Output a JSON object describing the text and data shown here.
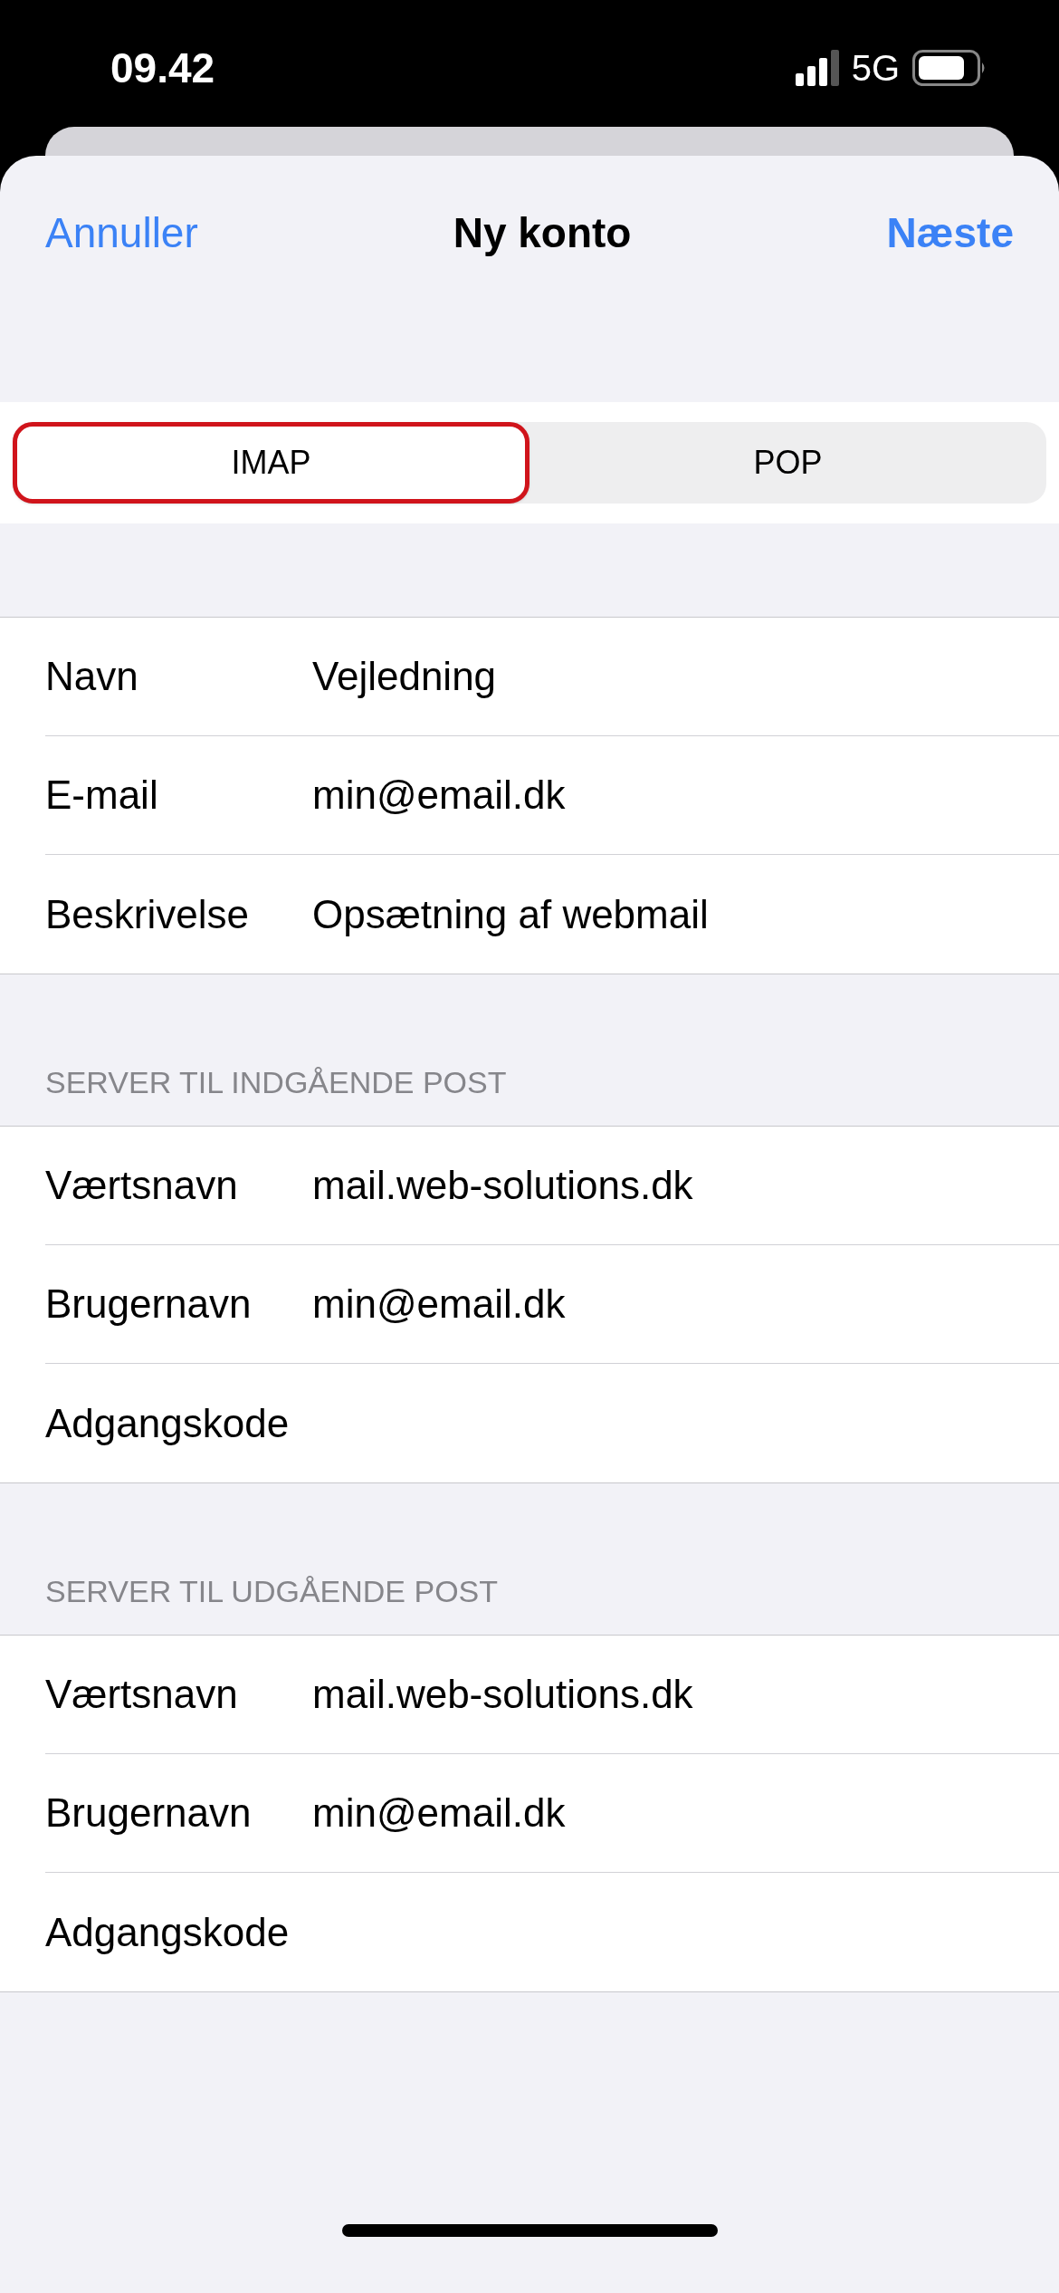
{
  "status_bar": {
    "time": "09.42",
    "network": "5G"
  },
  "nav": {
    "cancel": "Annuller",
    "title": "Ny konto",
    "next": "Næste"
  },
  "segments": [
    {
      "label": "IMAP",
      "selected": true,
      "outlined": true
    },
    {
      "label": "POP",
      "selected": false,
      "outlined": false
    }
  ],
  "sections": [
    {
      "rows": [
        {
          "label": "Navn",
          "value": "Vejledning"
        },
        {
          "label": "E-mail",
          "value": "min@email.dk"
        },
        {
          "label": "Beskrivelse",
          "value": "Opsætning af webmail"
        }
      ]
    },
    {
      "header": "SERVER TIL INDGÅENDE POST",
      "rows": [
        {
          "label": "Værtsnavn",
          "value": "mail.web-solutions.dk"
        },
        {
          "label": "Brugernavn",
          "value": "min@email.dk"
        },
        {
          "label": "Adgangskode"
        }
      ]
    },
    {
      "header": "SERVER TIL UDGÅENDE POST",
      "rows": [
        {
          "label": "Værtsnavn",
          "value": "mail.web-solutions.dk"
        },
        {
          "label": "Brugernavn",
          "value": "min@email.dk"
        },
        {
          "label": "Adgangskode"
        }
      ]
    }
  ]
}
